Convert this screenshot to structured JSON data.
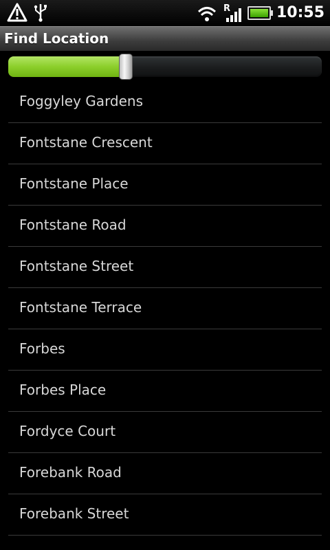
{
  "status_bar": {
    "time": "10:55",
    "roaming_label": "R",
    "icons": [
      "warning-icon",
      "usb-icon",
      "wifi-icon",
      "signal-icon",
      "battery-icon"
    ]
  },
  "header": {
    "title": "Find Location"
  },
  "slider": {
    "value_fraction": 0.375
  },
  "locations": [
    "Foggyley Gardens",
    "Fontstane Crescent",
    "Fontstane Place",
    "Fontstane Road",
    "Fontstane Street",
    "Fontstane Terrace",
    "Forbes",
    "Forbes Place",
    "Fordyce Court",
    "Forebank Road",
    "Forebank Street"
  ],
  "colors": {
    "slider_fill": "#8ccf2b",
    "battery": "#5ac81a"
  }
}
